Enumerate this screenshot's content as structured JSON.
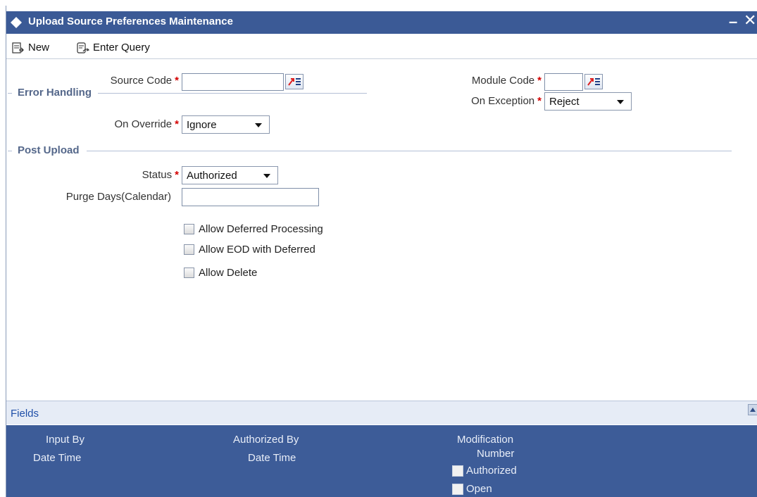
{
  "window": {
    "title": "Upload Source Preferences Maintenance",
    "minimize_glyph": "–",
    "close_glyph": "✕"
  },
  "toolbar": {
    "new_label": "New",
    "enter_query_label": "Enter Query"
  },
  "form": {
    "source_code": {
      "label": "Source Code",
      "required_mark": "*",
      "value": ""
    },
    "module_code": {
      "label": "Module Code",
      "required_mark": "*",
      "value": ""
    },
    "on_exception": {
      "label": "On Exception",
      "required_mark": "*",
      "value": "Reject"
    },
    "error_handling": {
      "section_title": "Error Handling",
      "on_override": {
        "label": "On Override",
        "required_mark": "*",
        "value": "Ignore"
      }
    },
    "post_upload": {
      "section_title": "Post Upload",
      "status": {
        "label": "Status",
        "required_mark": "*",
        "value": "Authorized"
      },
      "purge_days": {
        "label": "Purge Days(Calendar)",
        "value": ""
      },
      "checkboxes": [
        {
          "label": "Allow Deferred Processing",
          "checked": false
        },
        {
          "label": "Allow EOD with Deferred",
          "checked": false
        },
        {
          "label": "Allow Delete",
          "checked": false
        }
      ]
    }
  },
  "fields_bar": {
    "label": "Fields"
  },
  "footer": {
    "input_by": "Input By",
    "input_date_time": "Date Time",
    "authorized_by": "Authorized By",
    "authorized_date_time": "Date Time",
    "modification": "Modification",
    "number": "Number",
    "authorized_check": "Authorized",
    "open_check": "Open"
  },
  "colors": {
    "title_bar": "#3b5a96",
    "section_label": "#54678a",
    "required": "#d40000",
    "footer_bg": "#3d5c98"
  }
}
